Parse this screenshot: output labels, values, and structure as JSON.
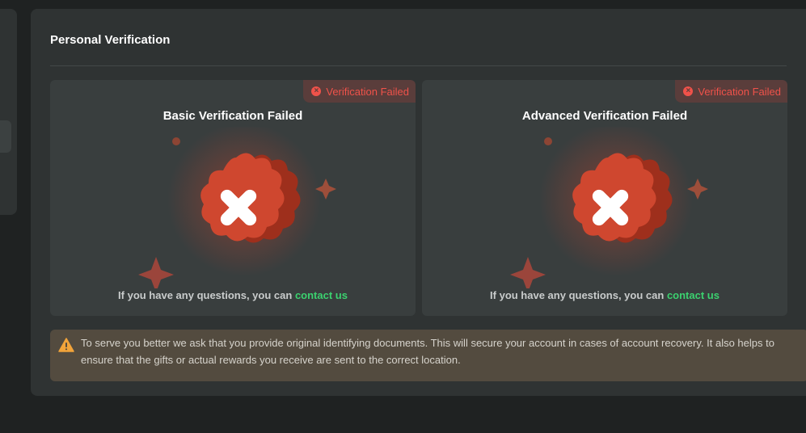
{
  "panel": {
    "title": "Personal Verification"
  },
  "cards": [
    {
      "title": "Basic Verification Failed",
      "badge": "Verification Failed",
      "footer_text": "If you have any questions, you can",
      "contact_link": "contact us"
    },
    {
      "title": "Advanced Verification Failed",
      "badge": "Verification Failed",
      "footer_text": "If you have any questions, you can",
      "contact_link": "contact us"
    }
  ],
  "notice": {
    "icon": "warning-icon",
    "text": "To serve you better we ask that you provide original identifying documents. This will secure your account in cases of account recovery. It also helps to ensure that the gifts or actual rewards you receive are sent to the correct location."
  },
  "colors": {
    "page_bg": "#1f2222",
    "panel_bg": "#2f3333",
    "card_bg": "#393e3e",
    "failed_red": "#f0524a",
    "link_green": "#3bd16f",
    "notice_bg": "#534b3f",
    "warning_orange": "#f2a43a"
  }
}
